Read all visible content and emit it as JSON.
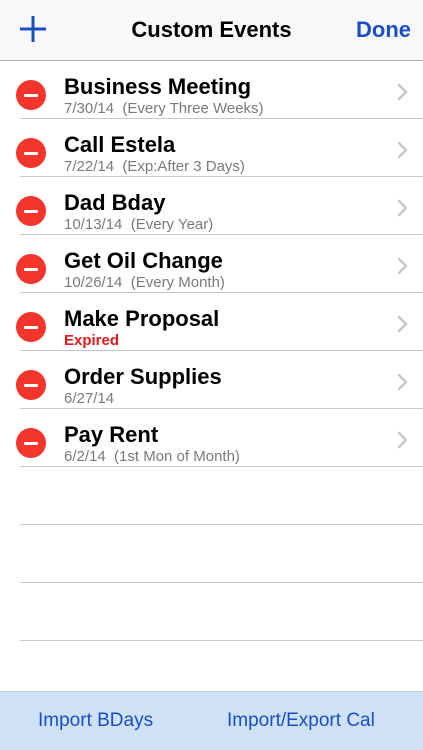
{
  "navbar": {
    "title": "Custom Events",
    "add_icon": "plus-icon",
    "done_label": "Done",
    "accent_color": "#1a4fc4"
  },
  "events": [
    {
      "title": "Business Meeting",
      "subtitle": "7/30/14  (Every Three Weeks)",
      "expired": false
    },
    {
      "title": "Call Estela",
      "subtitle": "7/22/14  (Exp:After 3 Days)",
      "expired": false
    },
    {
      "title": "Dad Bday",
      "subtitle": "10/13/14  (Every Year)",
      "expired": false
    },
    {
      "title": "Get Oil Change",
      "subtitle": "10/26/14  (Every Month)",
      "expired": false
    },
    {
      "title": "Make Proposal",
      "subtitle": "Expired",
      "expired": true
    },
    {
      "title": "Order Supplies",
      "subtitle": "6/27/14",
      "expired": false
    },
    {
      "title": "Pay Rent",
      "subtitle": "6/2/14  (1st Mon of Month)",
      "expired": false
    }
  ],
  "row_icons": {
    "delete": "minus-circle-icon",
    "disclosure": "chevron-right-icon"
  },
  "toolbar": {
    "import_bdays_label": "Import BDays",
    "import_export_label": "Import/Export Cal",
    "background_color": "#cfe1f5"
  },
  "colors": {
    "delete_red": "#f4352b",
    "expired_red": "#e0191b"
  }
}
